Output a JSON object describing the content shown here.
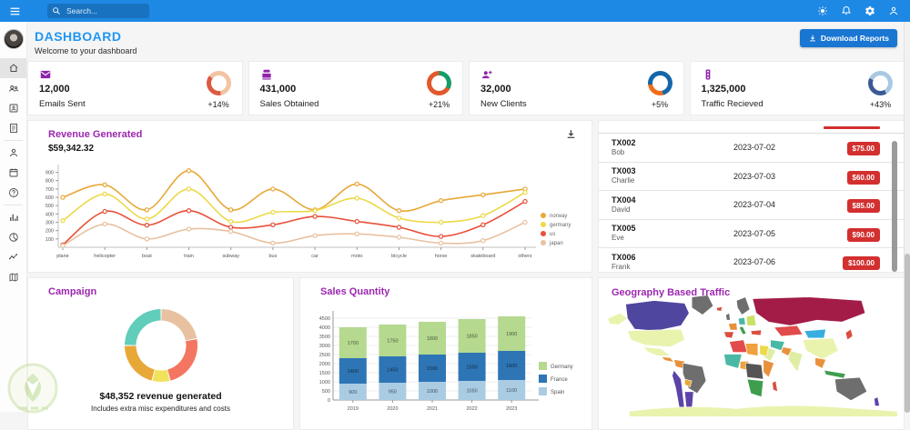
{
  "topbar": {
    "search_placeholder": "Search...",
    "icon_buttons": [
      "light-mode",
      "notifications",
      "settings",
      "profile"
    ]
  },
  "sidebar": {
    "items": [
      {
        "name": "dashboard",
        "icon": "home-icon",
        "active": true
      },
      {
        "name": "team",
        "icon": "people-icon"
      },
      {
        "name": "contacts",
        "icon": "contacts-icon"
      },
      {
        "name": "invoices",
        "icon": "receipt-icon"
      },
      {
        "divider": true
      },
      {
        "name": "profile-form",
        "icon": "person-icon"
      },
      {
        "name": "calendar",
        "icon": "calendar-icon"
      },
      {
        "name": "faq",
        "icon": "help-icon"
      },
      {
        "divider": true
      },
      {
        "name": "bar-chart",
        "icon": "bar-chart-icon"
      },
      {
        "name": "pie-chart",
        "icon": "pie-chart-icon"
      },
      {
        "name": "line-chart",
        "icon": "timeline-icon"
      },
      {
        "name": "geography",
        "icon": "map-icon"
      }
    ]
  },
  "header": {
    "title": "DASHBOARD",
    "subtitle": "Welcome to your dashboard",
    "download_label": "Download Reports"
  },
  "stats": [
    {
      "value": "12,000",
      "label": "Emails Sent",
      "delta": "+14%",
      "icon": "email-icon",
      "ring": {
        "fill": "#dd5a42",
        "track": "#f3c3a2",
        "pct": 38,
        "rotate": 170
      }
    },
    {
      "value": "431,000",
      "label": "Sales Obtained",
      "delta": "+21%",
      "icon": "point-of-sale-icon",
      "ring": {
        "fill": "#169c68",
        "track": "#e2572b",
        "pct": 33,
        "rotate": 0
      }
    },
    {
      "value": "32,000",
      "label": "New Clients",
      "delta": "+5%",
      "icon": "person-add-icon",
      "ring": {
        "fill": "#ef6c1a",
        "track": "#1566a8",
        "pct": 27,
        "rotate": 165
      }
    },
    {
      "value": "1,325,000",
      "label": "Traffic Recieved",
      "delta": "+43%",
      "icon": "traffic-icon",
      "ring": {
        "fill": "#3c5a96",
        "track": "#a9c9e2",
        "pct": 40,
        "rotate": 150
      }
    }
  ],
  "transactions": {
    "rows": [
      {
        "id": "TX002",
        "user": "Bob",
        "date": "2023-07-02",
        "amount": "$75.00"
      },
      {
        "id": "TX003",
        "user": "Charlie",
        "date": "2023-07-03",
        "amount": "$60.00"
      },
      {
        "id": "TX004",
        "user": "David",
        "date": "2023-07-04",
        "amount": "$85.00"
      },
      {
        "id": "TX005",
        "user": "Eve",
        "date": "2023-07-05",
        "amount": "$90.00"
      },
      {
        "id": "TX006",
        "user": "Frank",
        "date": "2023-07-06",
        "amount": "$100.00"
      }
    ],
    "badge_color": "#d32f2f"
  },
  "geo": {
    "title": "Geography Based Traffic",
    "regions": [
      {
        "name": "alaska",
        "color": "#e9f3ae"
      },
      {
        "name": "canada",
        "color": "#4f46a0"
      },
      {
        "name": "greenland",
        "color": "#6e6e6e"
      },
      {
        "name": "usa",
        "color": "#e9f3ae"
      },
      {
        "name": "mexico",
        "color": "#e9f3ae"
      },
      {
        "name": "central-america",
        "color": "#e8913c"
      },
      {
        "name": "colombia",
        "color": "#e8913c"
      },
      {
        "name": "peru-chile",
        "color": "#5b43a8"
      },
      {
        "name": "brazil",
        "color": "#6e6e6e"
      },
      {
        "name": "argentina",
        "color": "#5b43a8"
      },
      {
        "name": "bolivia",
        "color": "#e8a838"
      },
      {
        "name": "iceland",
        "color": "#d94f3f"
      },
      {
        "name": "uk",
        "color": "#6e6e6e"
      },
      {
        "name": "scandinavia",
        "color": "#6e6e6e"
      },
      {
        "name": "france",
        "color": "#e8913c"
      },
      {
        "name": "spain",
        "color": "#d94f3f"
      },
      {
        "name": "germany",
        "color": "#49b9a5"
      },
      {
        "name": "eastern-europe",
        "color": "#c9e265"
      },
      {
        "name": "italy",
        "color": "#3f9e4d"
      },
      {
        "name": "turkey",
        "color": "#d94f3f"
      },
      {
        "name": "russia",
        "color": "#a21c47"
      },
      {
        "name": "kazakhstan",
        "color": "#e14b4b"
      },
      {
        "name": "mongolia",
        "color": "#38aee0"
      },
      {
        "name": "china",
        "color": "#e9f3ae"
      },
      {
        "name": "india",
        "color": "#dfeea2"
      },
      {
        "name": "pakistan",
        "color": "#e8913c"
      },
      {
        "name": "iran",
        "color": "#49b9a5"
      },
      {
        "name": "saudi-arabia",
        "color": "#dfeea2"
      },
      {
        "name": "north-africa",
        "color": "#e14b4b"
      },
      {
        "name": "libya",
        "color": "#f0a13d"
      },
      {
        "name": "egypt",
        "color": "#ecd94c"
      },
      {
        "name": "west-africa",
        "color": "#49b9a5"
      },
      {
        "name": "nigeria",
        "color": "#f0a13d"
      },
      {
        "name": "central-africa",
        "color": "#555555"
      },
      {
        "name": "east-africa",
        "color": "#e8913c"
      },
      {
        "name": "southern-africa",
        "color": "#3f9e4d"
      },
      {
        "name": "madagascar",
        "color": "#d94f3f"
      },
      {
        "name": "southeast-asia",
        "color": "#e8913c"
      },
      {
        "name": "indonesia",
        "color": "#3f9e4d"
      },
      {
        "name": "japan",
        "color": "#d94f3f"
      },
      {
        "name": "australia",
        "color": "#6e6e6e"
      },
      {
        "name": "new-zealand",
        "color": "#5b43a8"
      },
      {
        "name": "antarctica",
        "color": "#e9f3ae"
      }
    ]
  },
  "chart_data": [
    {
      "id": "revenue-line",
      "type": "line",
      "title": "Revenue Generated",
      "subtitle": "$59,342.32",
      "x": [
        "plane",
        "helicopter",
        "boat",
        "train",
        "subway",
        "bus",
        "car",
        "moto",
        "bicycle",
        "horse",
        "skateboard",
        "others"
      ],
      "series": [
        {
          "name": "norway",
          "color": "#e8a838",
          "values": [
            600,
            750,
            450,
            920,
            450,
            700,
            450,
            760,
            440,
            560,
            630,
            700
          ]
        },
        {
          "name": "germany",
          "color": "#ecd948",
          "values": [
            320,
            640,
            340,
            700,
            310,
            420,
            440,
            590,
            350,
            300,
            380,
            660
          ]
        },
        {
          "name": "us",
          "color": "#e8503a",
          "values": [
            30,
            430,
            265,
            440,
            240,
            270,
            370,
            310,
            240,
            130,
            270,
            550
          ]
        },
        {
          "name": "japan",
          "color": "#e8c1a0",
          "values": [
            20,
            280,
            100,
            220,
            190,
            50,
            140,
            160,
            120,
            50,
            80,
            300
          ]
        }
      ],
      "ylim": [
        0,
        950
      ],
      "yticks": [
        100,
        200,
        300,
        400,
        500,
        600,
        700,
        800,
        900
      ],
      "legend_position": "right",
      "grid": false
    },
    {
      "id": "campaign-donut",
      "type": "pie",
      "title": "Campaign",
      "slices": [
        {
          "color": "#e8c1a0",
          "value": 22
        },
        {
          "color": "#f47560",
          "value": 24
        },
        {
          "color": "#f1e15b",
          "value": 8
        },
        {
          "color": "#e8a838",
          "value": 21
        },
        {
          "color": "#61cdbb",
          "value": 25
        }
      ],
      "center_label": "$48,352 revenue generated",
      "note": "Includes extra misc expenditures and costs"
    },
    {
      "id": "sales-bar",
      "type": "bar",
      "stacked": true,
      "title": "Sales Quantity",
      "categories": [
        "2019",
        "2020",
        "2021",
        "2022",
        "2023"
      ],
      "series": [
        {
          "name": "Spain",
          "color": "#a9cce3",
          "values": [
            900,
            950,
            1000,
            1050,
            1100
          ]
        },
        {
          "name": "France",
          "color": "#2e75b6",
          "values": [
            1400,
            1450,
            1500,
            1550,
            1600
          ]
        },
        {
          "name": "Germany",
          "color": "#b5d98f",
          "values": [
            1700,
            1750,
            1800,
            1850,
            1900
          ]
        }
      ],
      "ylim": [
        0,
        4700
      ],
      "ytick_step": 500,
      "legend_position": "right",
      "legend_order": [
        "Germany",
        "France",
        "Spain"
      ]
    }
  ]
}
